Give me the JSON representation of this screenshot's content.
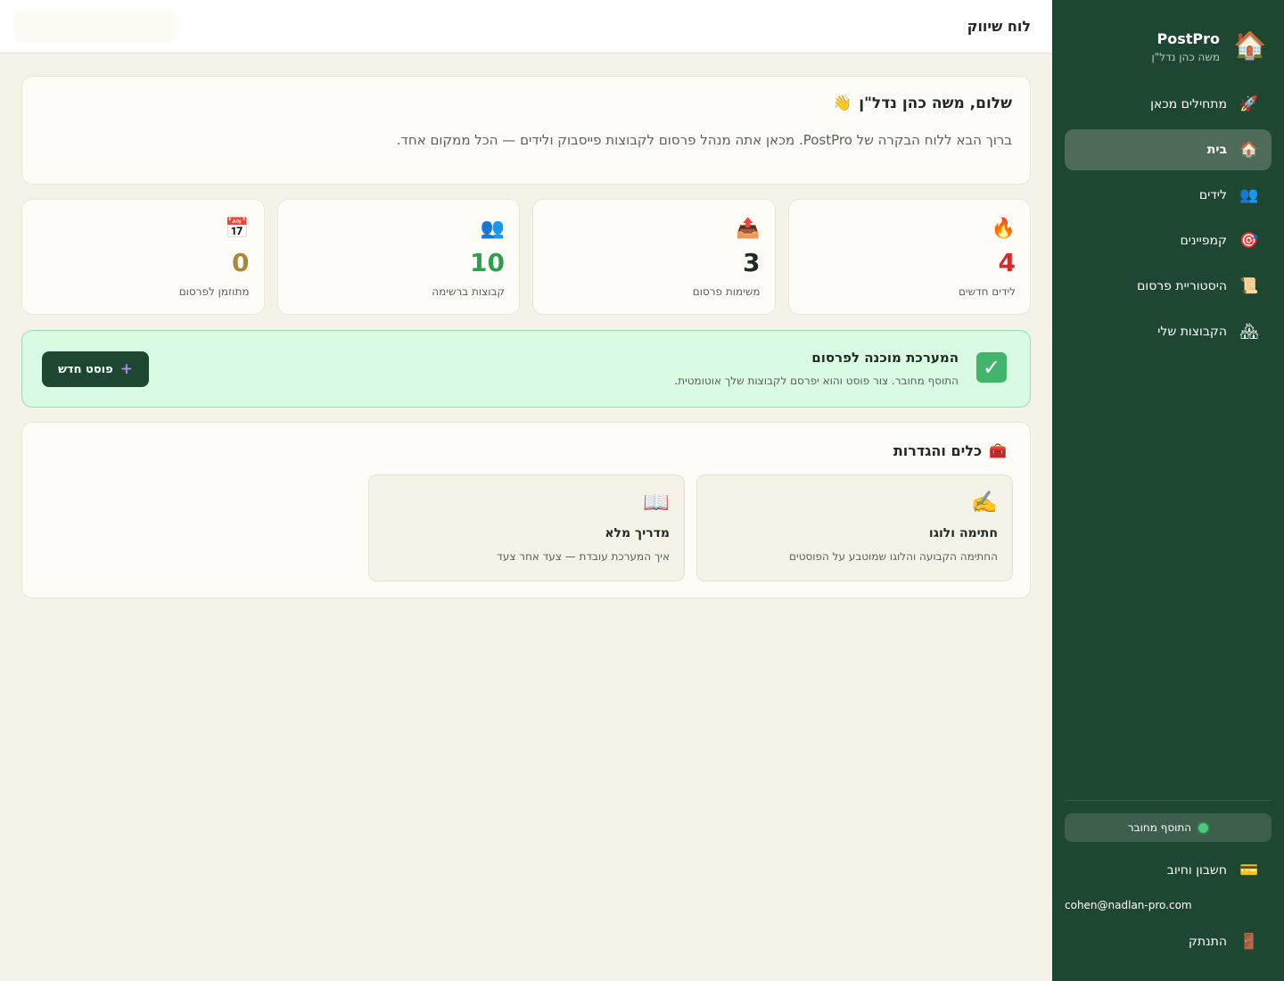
{
  "header": {
    "title": "לוח שיווק",
    "search_placeholder": ""
  },
  "brand": {
    "name": "PostPro",
    "user": "משה כהן נדל\"ן",
    "logo_icon": "🏠"
  },
  "sidebar": {
    "items": [
      {
        "label": "מתחילים מכאן",
        "icon": "🚀",
        "icon_name": "rocket-icon"
      },
      {
        "label": "בית",
        "icon": "🏠",
        "icon_name": "house-icon"
      },
      {
        "label": "לידים",
        "icon": "👥",
        "icon_name": "people-icon"
      },
      {
        "label": "קמפיינים",
        "icon": "🎯",
        "icon_name": "target-icon"
      },
      {
        "label": "היסטוריית פרסום",
        "icon": "📜",
        "icon_name": "scroll-icon"
      },
      {
        "label": "הקבוצות שלי",
        "icon": "🏘",
        "icon_name": "houses-icon"
      }
    ],
    "active_index": 1,
    "extension_status": "התוסף מחובר",
    "billing": {
      "label": "חשבון וחיוב",
      "icon": "💳"
    },
    "email": "cohen@nadlan-pro.com",
    "logout": {
      "label": "התנתק",
      "icon": "🚪"
    }
  },
  "welcome": {
    "title": "שלום, משה כהן נדל\"ן",
    "icon": "👋",
    "subtitle": "ברוך הבא ללוח הבקרה של PostPro. מכאן אתה מנהל פרסום לקבוצות פייסבוק ולידים — הכל ממקום אחד."
  },
  "stats": [
    {
      "icon": "🔥",
      "value": "4",
      "label": "לידים חדשים",
      "color": "#d42a2a"
    },
    {
      "icon": "📤",
      "value": "3",
      "label": "משימות פרסום",
      "color": "#1f2a24"
    },
    {
      "icon": "👥",
      "value": "10",
      "label": "קבוצות ברשימה",
      "color": "#2e9e4f"
    },
    {
      "icon": "📅",
      "value": "0",
      "label": "מתוזמן לפרסום",
      "color": "#a8883a"
    }
  ],
  "ready": {
    "title": "המערכת מוכנה לפרסום",
    "subtitle": "התוסף מחובר. צור פוסט והוא יפרסם לקבוצות שלך אוטומטית.",
    "check": "✓",
    "button_label": "פוסט חדש",
    "button_icon": "+"
  },
  "tools": {
    "title": "כלים והגדרות",
    "icon": "🧰",
    "cards": [
      {
        "icon": "✍️",
        "title": "חתימה ולוגו",
        "subtitle": "החתימה הקבועה והלוגו שמוטבע על הפוסטים"
      },
      {
        "icon": "📖",
        "title": "מדריך מלא",
        "subtitle": "איך המערכת עובדת — צעד אחר צעד"
      }
    ]
  },
  "colors": {
    "sidebar_bg": "#1d4731",
    "accent_green": "#2e9e4f",
    "ready_bg": "#d9fae3"
  }
}
